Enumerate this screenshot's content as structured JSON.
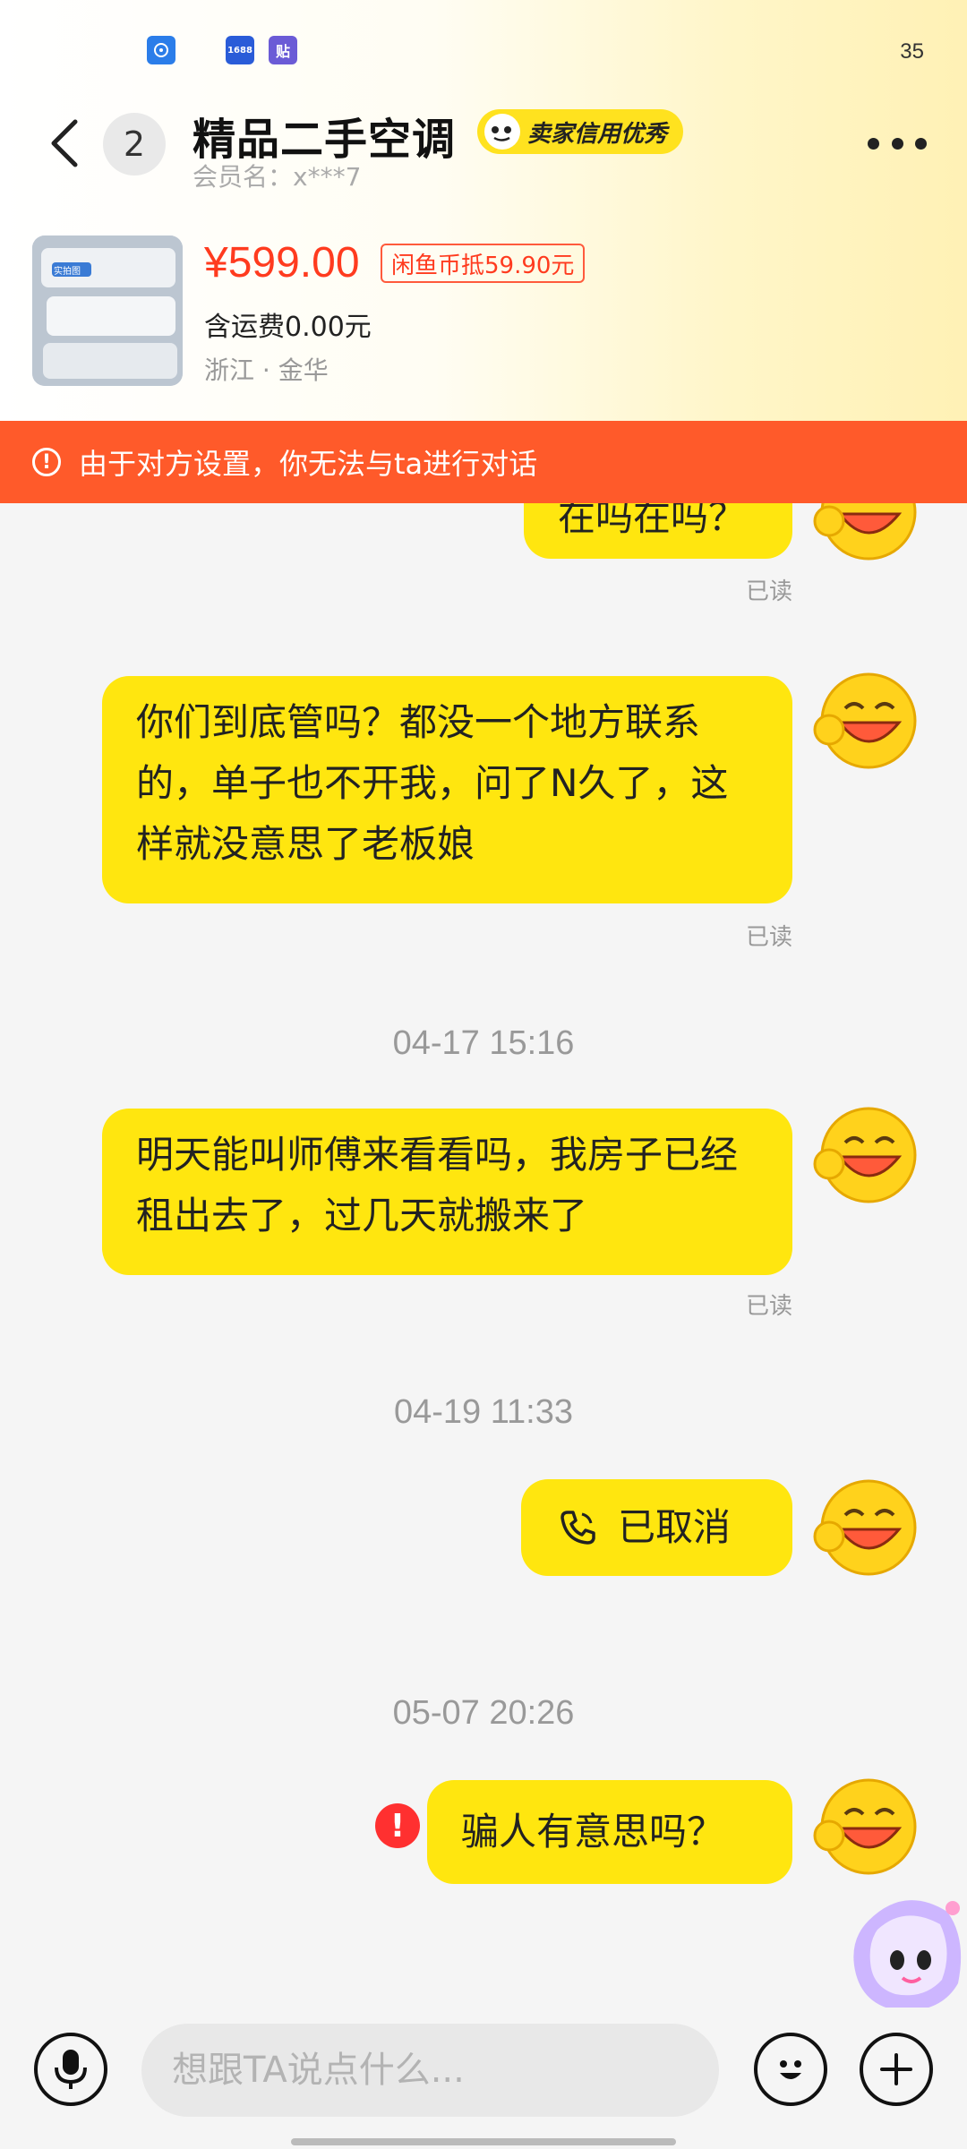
{
  "status_bar": {
    "time": "35",
    "apps": [
      "1688",
      "贴"
    ]
  },
  "header": {
    "back_count": "2",
    "title": "精品二手空调",
    "credit_badge": "卖家信用优秀",
    "member": "会员名：x***7"
  },
  "product": {
    "price": "¥599.00",
    "coin_discount": "闲鱼币抵59.90元",
    "shipping": "含运费0.00元",
    "location": "浙江 · 金华",
    "thumb_label": "实拍图"
  },
  "banner": {
    "text": "由于对方设置，你无法与ta进行对话"
  },
  "chat": {
    "messages": [
      {
        "text": "在吗在吗？",
        "status": "已读"
      },
      {
        "text": "你们到底管吗？都没一个地方联系的，单子也不开我，问了N久了，这样就没意思了老板娘",
        "status": "已读"
      },
      {
        "timestamp": "04-17 15:16",
        "text": "明天能叫师傅来看看吗，我房子已经租出去了，过几天就搬来了",
        "status": "已读"
      },
      {
        "timestamp": "04-19 11:33",
        "text": "已取消",
        "type": "call"
      },
      {
        "timestamp": "05-07 20:26",
        "text": "骗人有意思吗？",
        "error": true
      }
    ]
  },
  "input": {
    "placeholder": "想跟TA说点什么..."
  },
  "icons": {
    "voice": "microphone-icon",
    "emoji": "emoji-icon",
    "plus": "plus-icon",
    "call": "phone-icon"
  },
  "colors": {
    "bubble": "#ffe60f",
    "banner": "#ff5a2a",
    "price": "#ff3b1f",
    "credit_badge": "#ffe21f"
  }
}
